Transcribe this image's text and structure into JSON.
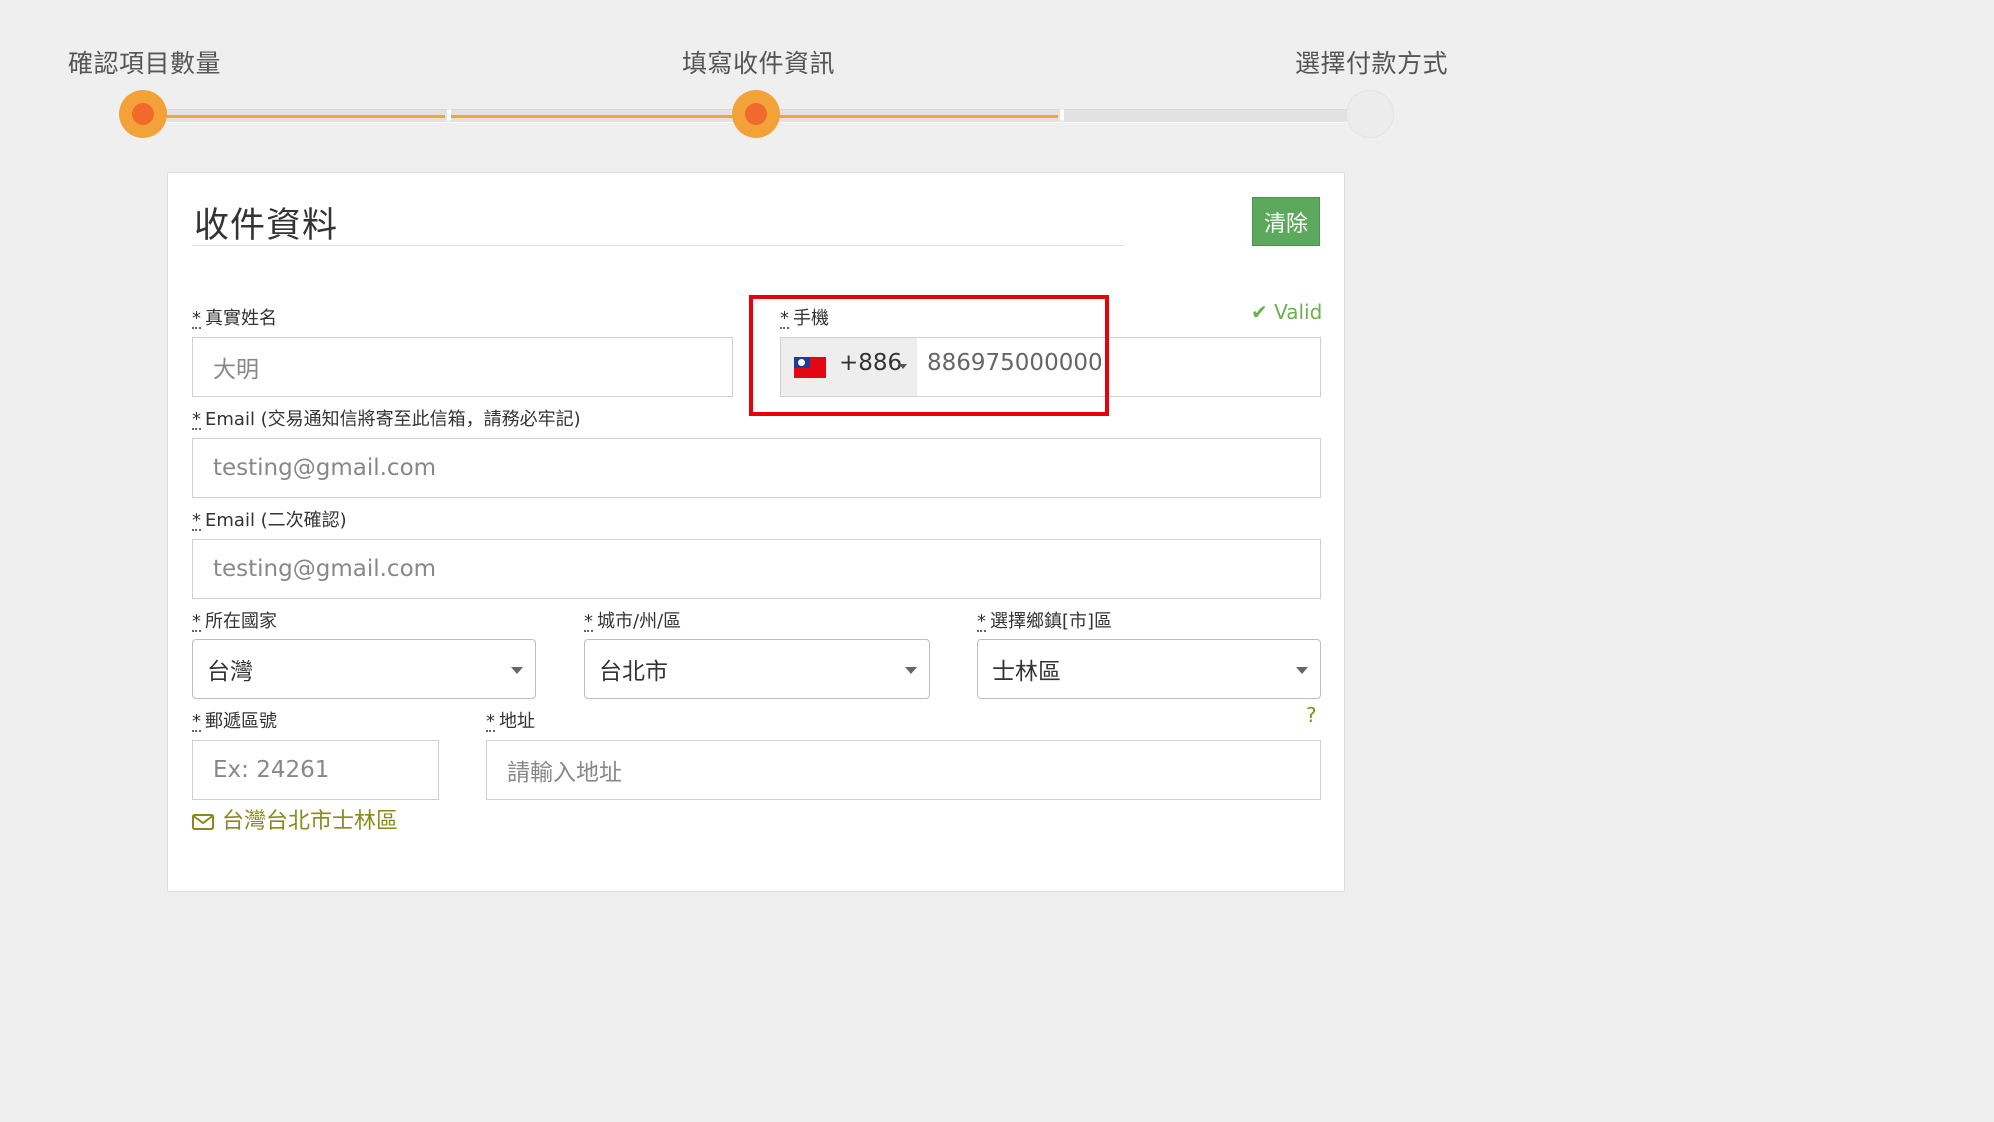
{
  "stepper": {
    "steps": [
      {
        "label": "確認項目數量",
        "state": "done"
      },
      {
        "label": "填寫收件資訊",
        "state": "current"
      },
      {
        "label": "選擇付款方式",
        "state": "todo"
      }
    ],
    "accent_color": "#f3a23a",
    "dot_color": "#ef6a2c"
  },
  "form": {
    "title": "收件資料",
    "clear_button": "清除",
    "required_mark": "*",
    "name": {
      "label": "真實姓名",
      "placeholder": "大明"
    },
    "phone": {
      "label": "手機",
      "validation": "✔ Valid",
      "country_flag": "taiwan-flag-icon",
      "dial_code": "+886",
      "value": "886975000000"
    },
    "email": {
      "label": "Email (交易通知信將寄至此信箱，請務必牢記)",
      "placeholder": "testing@gmail.com"
    },
    "email_confirm": {
      "label": "Email (二次確認)",
      "placeholder": "testing@gmail.com"
    },
    "country": {
      "label": "所在國家",
      "value": "台灣"
    },
    "city": {
      "label": "城市/州/區",
      "value": "台北市"
    },
    "district": {
      "label": "選擇鄉鎮[市]區",
      "value": "士林區"
    },
    "postcode": {
      "label": "郵遞區號",
      "placeholder": "Ex: 24261"
    },
    "address": {
      "label": "地址",
      "placeholder": "請輸入地址",
      "help": "?"
    },
    "address_preview": "台灣台北市士林區"
  },
  "colors": {
    "clear_button": "#5ca85c",
    "valid": "#6ab04c",
    "highlight_box": "#e8000d",
    "preview_text": "#8a8a1c"
  }
}
